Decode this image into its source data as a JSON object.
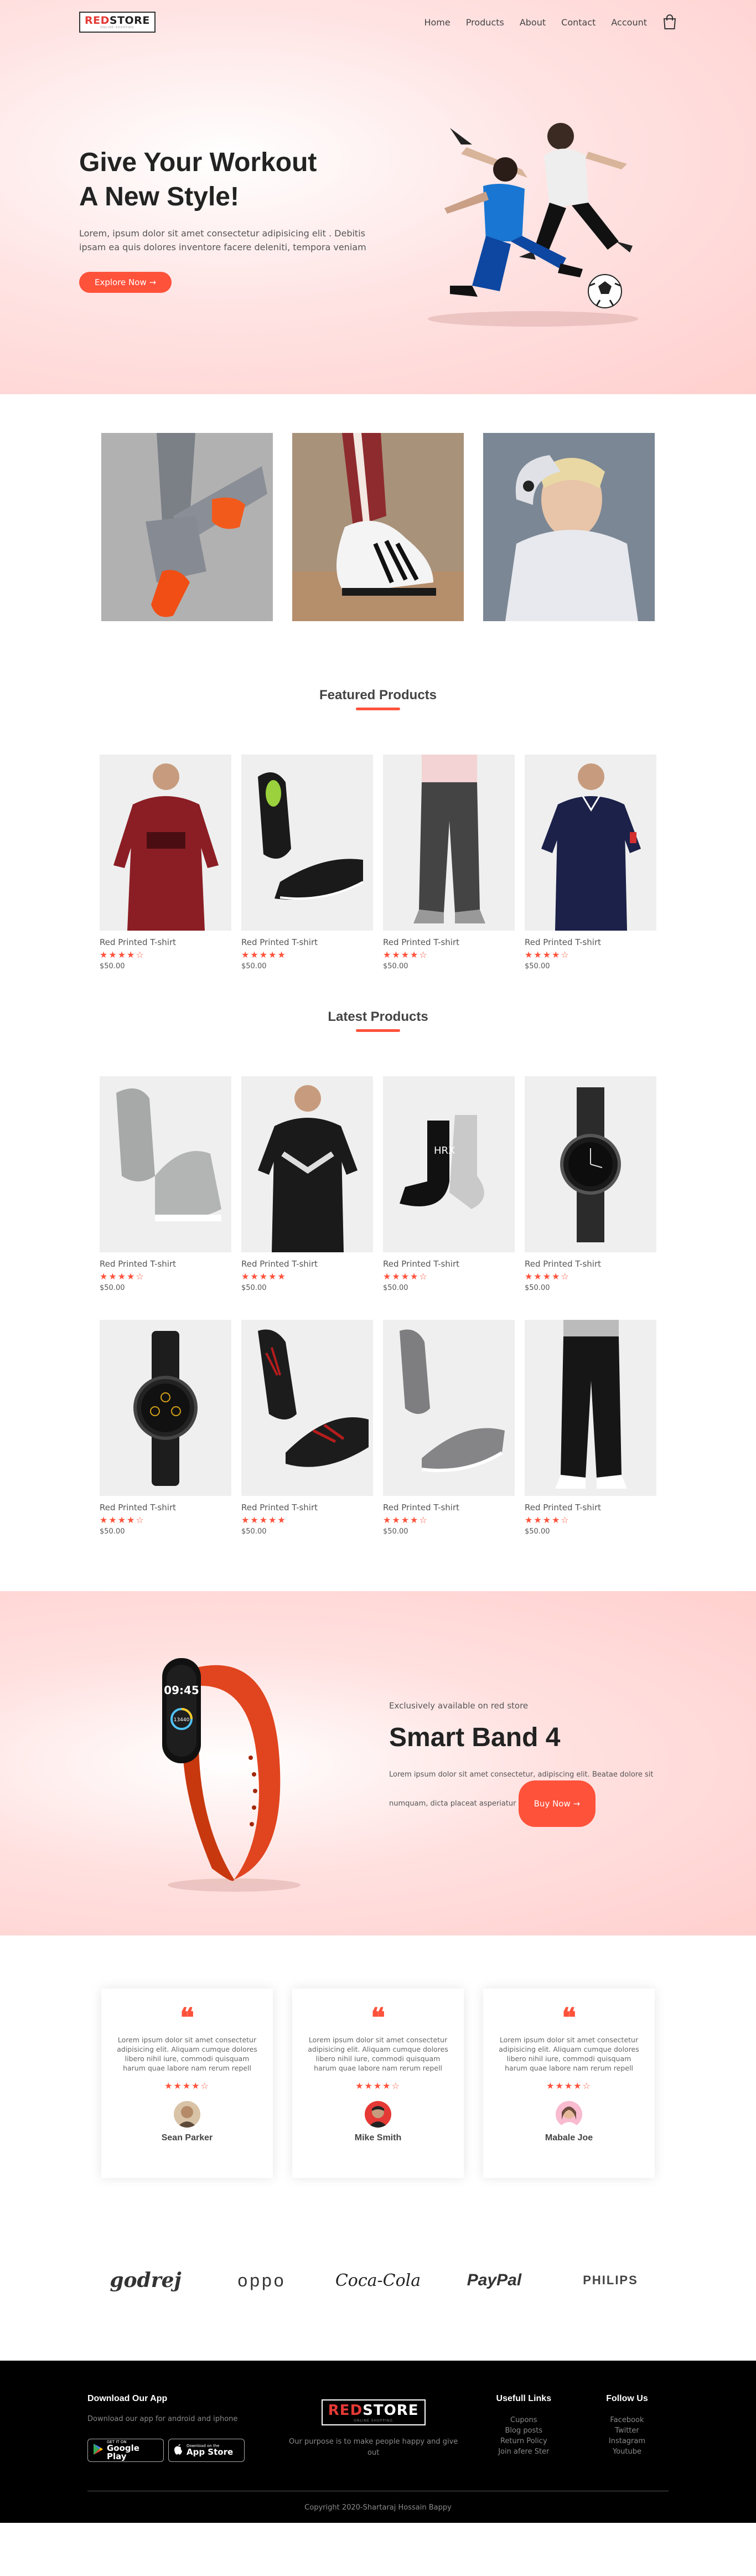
{
  "header": {
    "logo_main_red": "RED",
    "logo_main_dark": "STORE",
    "logo_tag": "ONLINE SHOPPING",
    "nav": [
      "Home",
      "Products",
      "About",
      "Contact",
      "Account"
    ],
    "cart_icon": "shopping-bag-icon"
  },
  "hero": {
    "title_line1": "Give Your Workout",
    "title_line2": "A New Style!",
    "description": "Lorem, ipsum dolor sit amet consectetur adipisicing elit . Debitis ipsam ea quis dolores inventore facere deleniti, tempora veniam",
    "button": "Explore Now →"
  },
  "featured": {
    "title": "Featured Products",
    "products": [
      {
        "name": "Red Printed T-shirt",
        "stars": "★★★★☆",
        "price": "$50.00"
      },
      {
        "name": "Red Printed T-shirt",
        "stars": "★★★★★",
        "price": "$50.00"
      },
      {
        "name": "Red Printed T-shirt",
        "stars": "★★★★☆",
        "price": "$50.00"
      },
      {
        "name": "Red Printed T-shirt",
        "stars": "★★★★☆",
        "price": "$50.00"
      }
    ]
  },
  "latest": {
    "title": "Latest Products",
    "products": [
      {
        "name": "Red Printed T-shirt",
        "stars": "★★★★☆",
        "price": "$50.00"
      },
      {
        "name": "Red Printed T-shirt",
        "stars": "★★★★★",
        "price": "$50.00"
      },
      {
        "name": "Red Printed T-shirt",
        "stars": "★★★★☆",
        "price": "$50.00"
      },
      {
        "name": "Red Printed T-shirt",
        "stars": "★★★★☆",
        "price": "$50.00"
      },
      {
        "name": "Red Printed T-shirt",
        "stars": "★★★★☆",
        "price": "$50.00"
      },
      {
        "name": "Red Printed T-shirt",
        "stars": "★★★★★",
        "price": "$50.00"
      },
      {
        "name": "Red Printed T-shirt",
        "stars": "★★★★☆",
        "price": "$50.00"
      },
      {
        "name": "Red Printed T-shirt",
        "stars": "★★★★☆",
        "price": "$50.00"
      }
    ]
  },
  "offer": {
    "small": "Exclusively available on red store",
    "title": "Smart Band 4",
    "desc_1": "Lorem ipsum dolor sit amet consectetur, adipiscing elit. Beatae dolore sit",
    "desc_2": "numquam, dicta placeat asperiatur",
    "button": "Buy Now →",
    "watch_time": "09:45",
    "watch_steps": "13440"
  },
  "testimonials": [
    {
      "text": "Lorem ipsum dolor sit amet consectetur adipisicing elit. Aliquam cumque dolores libero nihil iure, commodi quisquam harum quae labore nam rerum repell",
      "stars": "★★★★☆",
      "name": "Sean Parker"
    },
    {
      "text": "Lorem ipsum dolor sit amet consectetur adipisicing elit. Aliquam cumque dolores libero nihil iure, commodi quisquam harum quae labore nam rerum repell",
      "stars": "★★★★☆",
      "name": "Mike Smith"
    },
    {
      "text": "Lorem ipsum dolor sit amet consectetur adipisicing elit. Aliquam cumque dolores libero nihil iure, commodi quisquam harum quae labore nam rerum repell",
      "stars": "★★★★☆",
      "name": "Mabale Joe"
    }
  ],
  "testimonial_quote": "❝",
  "brands": [
    "godrej",
    "oppo",
    "Coca-Cola",
    "PayPal",
    "PHILIPS"
  ],
  "footer": {
    "download_title": "Download Our App",
    "download_text": "Download our app for android and iphone",
    "google_top": "GET IT ON",
    "google_main": "Google Play",
    "apple_top": "Download on the",
    "apple_main": "App Store",
    "logo_red": "RED",
    "logo_white": "STORE",
    "logo_tag": "ONLINE SHOPPING",
    "purpose": "Our purpose is to make people happy and give out",
    "links_title": "Usefull Links",
    "links": [
      "Cupons",
      "Blog posts",
      "Return Policy",
      "Join afere Ster"
    ],
    "follow_title": "Follow Us",
    "follow": [
      "Facebook",
      "Twitter",
      "Instagram",
      "Youtube"
    ],
    "copyright": "Copyright 2020-Shartaraj Hossain Bappy"
  },
  "colors": {
    "accent": "#ff523b",
    "logo_red": "#e53935",
    "footer_bg": "#000000"
  }
}
